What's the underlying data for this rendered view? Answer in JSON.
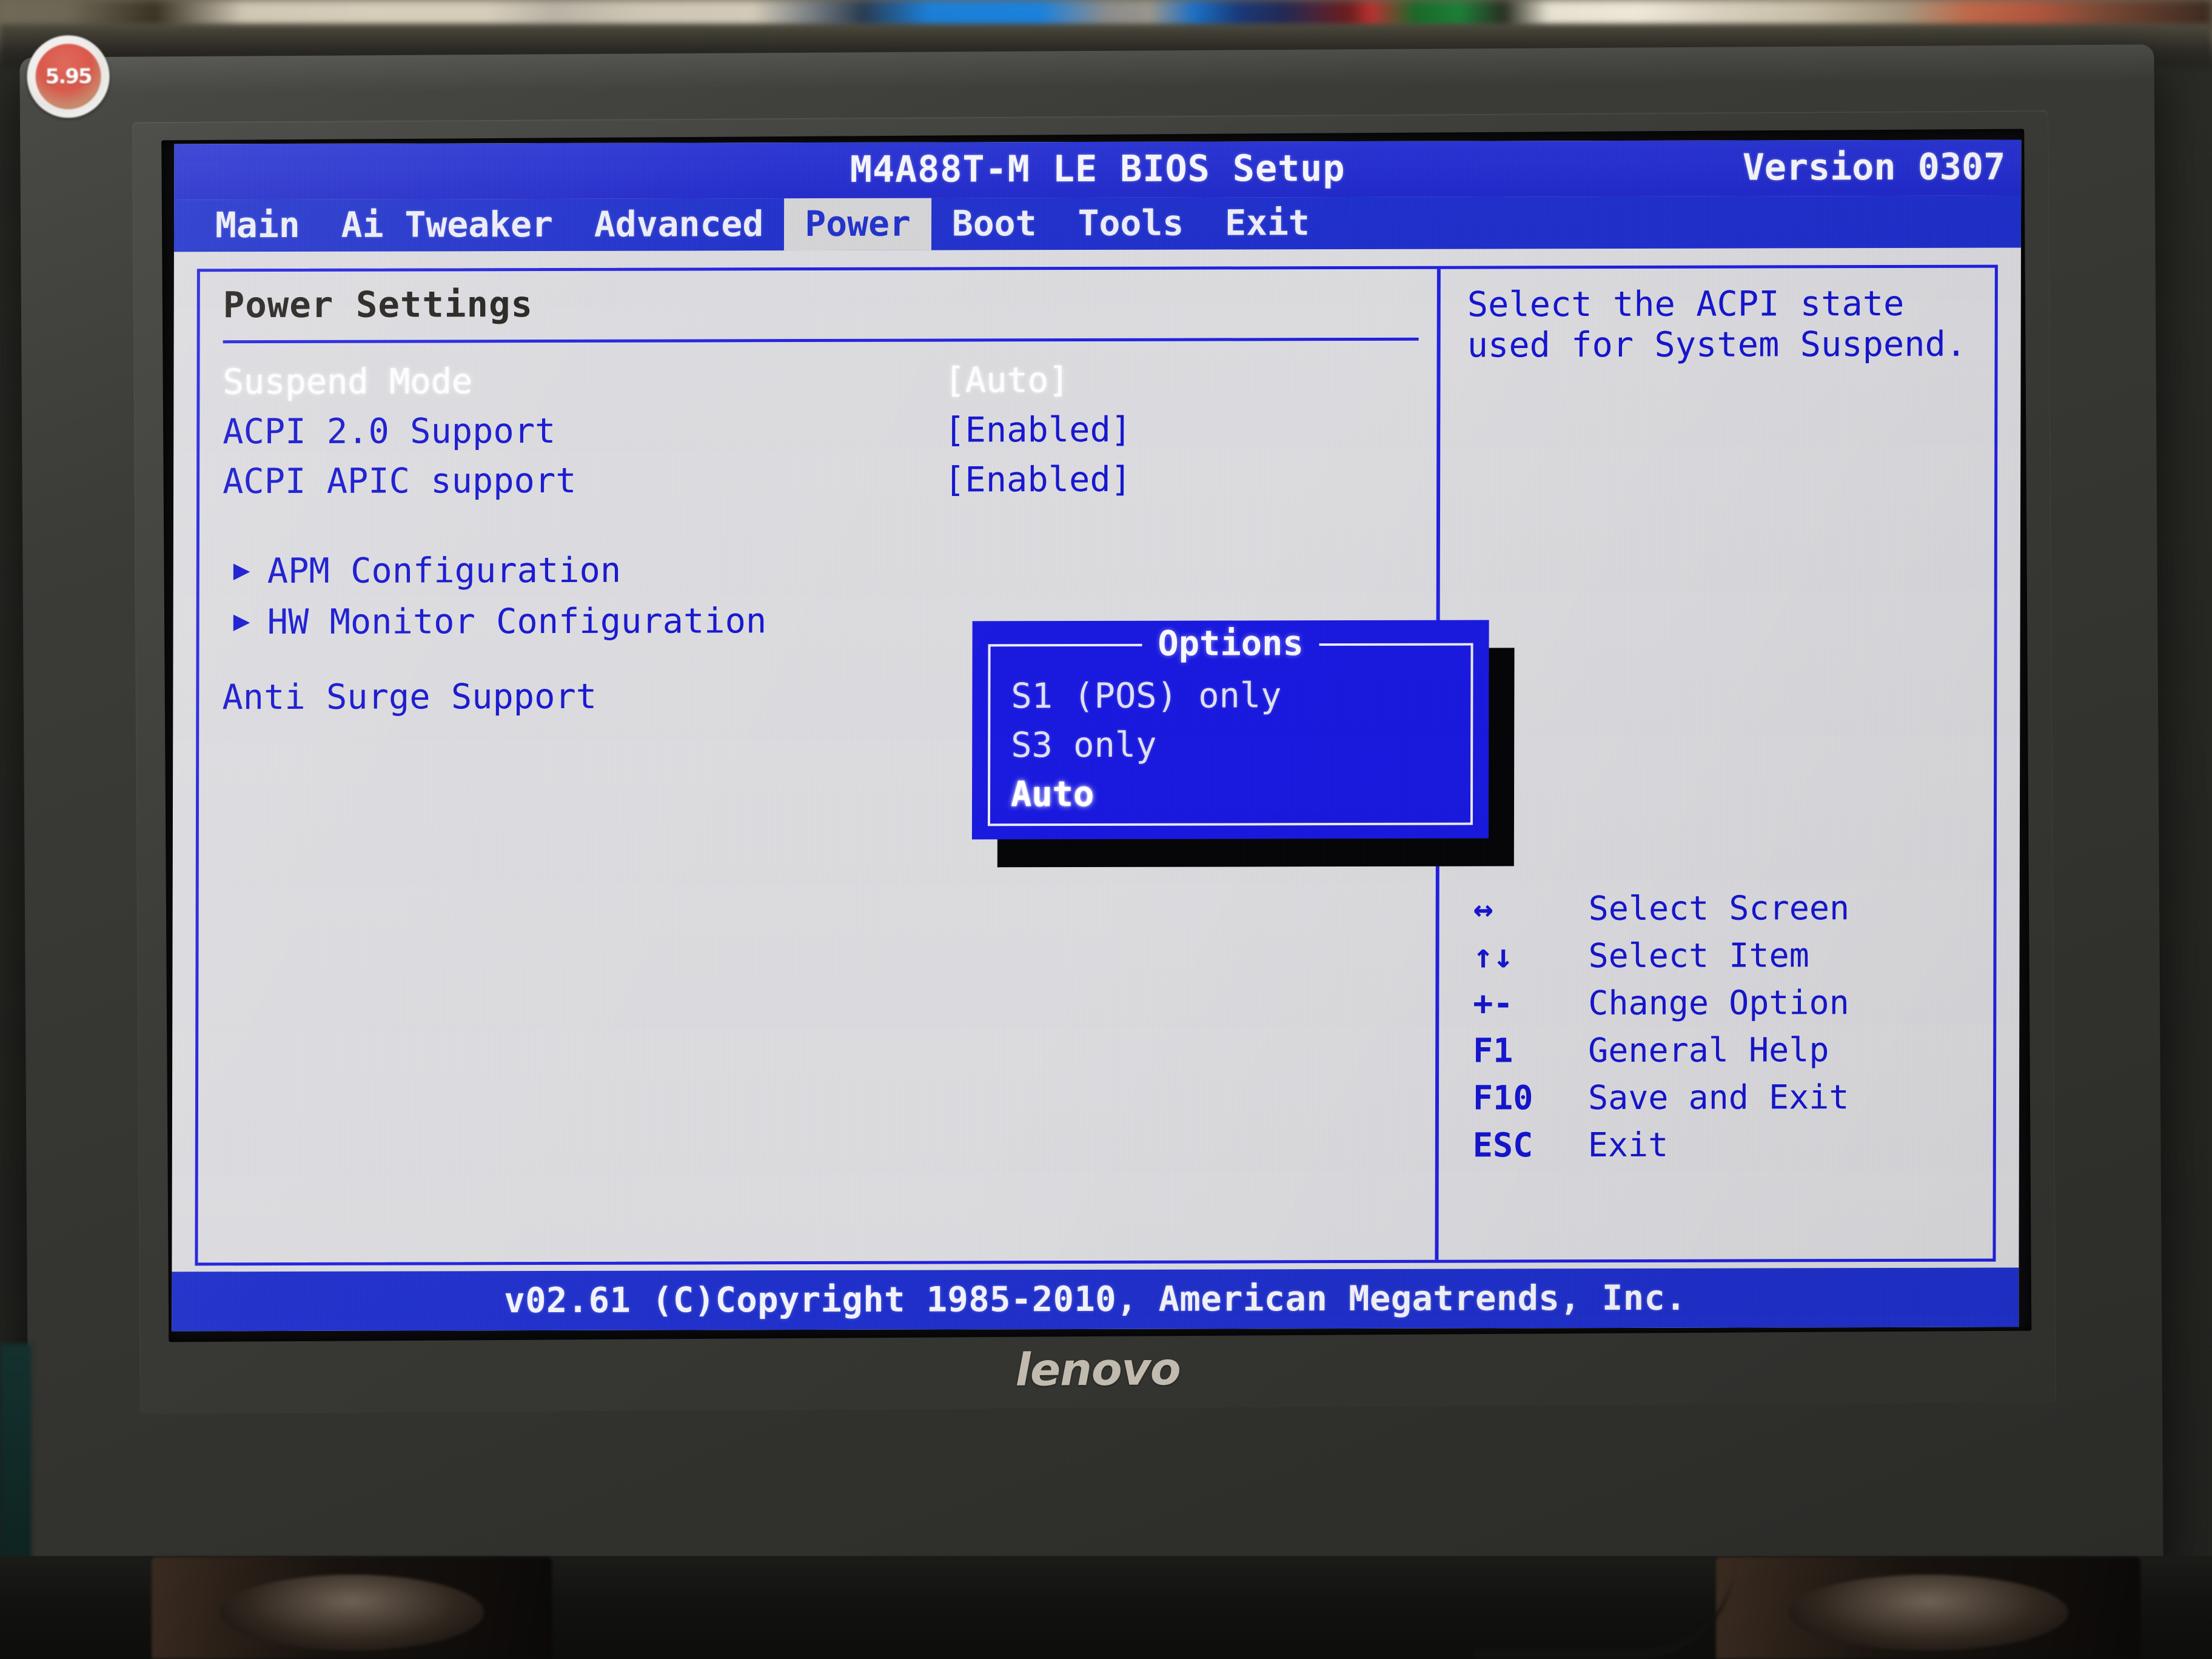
{
  "scene": {
    "monitor_brand": "lenovo",
    "sticker_text": "5.95"
  },
  "bios": {
    "title": "M4A88T-M LE BIOS Setup",
    "version": "Version 0307",
    "tabs": [
      {
        "label": "Main",
        "active": false
      },
      {
        "label": "Ai Tweaker",
        "active": false
      },
      {
        "label": "Advanced",
        "active": false
      },
      {
        "label": "Power",
        "active": true
      },
      {
        "label": "Boot",
        "active": false
      },
      {
        "label": "Tools",
        "active": false
      },
      {
        "label": "Exit",
        "active": false
      }
    ],
    "section_title": "Power Settings",
    "settings": [
      {
        "label": "Suspend Mode",
        "value": "[Auto]",
        "selected": true
      },
      {
        "label": "ACPI 2.0 Support",
        "value": "[Enabled]",
        "selected": false
      },
      {
        "label": "ACPI APIC support",
        "value": "[Enabled]",
        "selected": false
      }
    ],
    "submenus": [
      {
        "label": "APM Configuration"
      },
      {
        "label": "HW Monitor Configuration"
      }
    ],
    "extra_item": {
      "label": "Anti Surge Support"
    },
    "help_text": "Select the ACPI state used for System Suspend.",
    "legend": [
      {
        "key": "↔",
        "desc": "Select Screen"
      },
      {
        "key": "↑↓",
        "desc": "Select Item"
      },
      {
        "key": "+-",
        "desc": "Change Option"
      },
      {
        "key": "F1",
        "desc": "General Help"
      },
      {
        "key": "F10",
        "desc": "Save and Exit"
      },
      {
        "key": "ESC",
        "desc": "Exit"
      }
    ],
    "footer": "v02.61 (C)Copyright 1985-2010, American Megatrends, Inc."
  },
  "dialog": {
    "title": "Options",
    "options": [
      {
        "label": "S1 (POS) only",
        "selected": false
      },
      {
        "label": "S3 only",
        "selected": false
      },
      {
        "label": "Auto",
        "selected": true
      }
    ]
  },
  "colors": {
    "screen_bg": "#d7d7db",
    "bios_blue": "#1616c8",
    "bar_blue": "#2030c4",
    "dialog_blue": "#1a1ad8",
    "highlight_white": "#ffffff",
    "section_title": "#24211e"
  }
}
